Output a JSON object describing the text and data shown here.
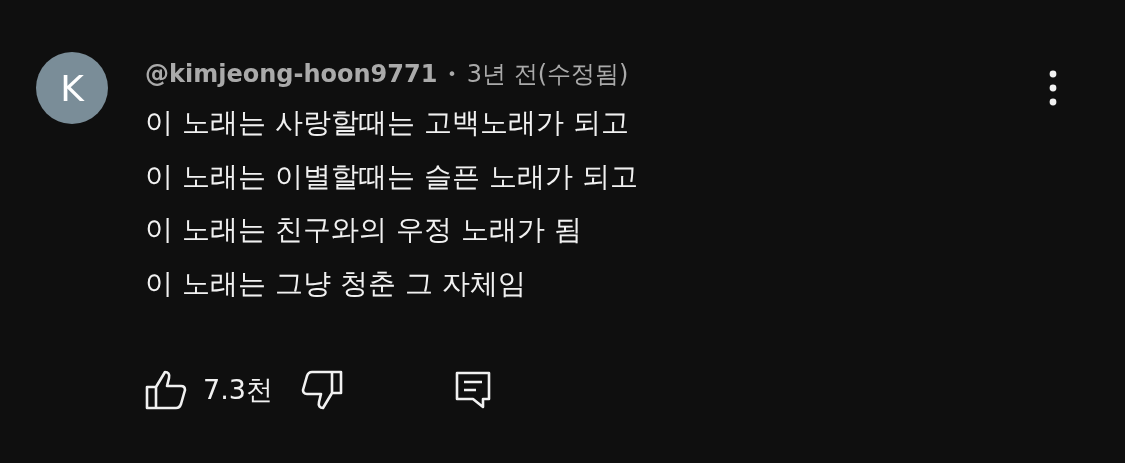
{
  "comment": {
    "avatar_letter": "K",
    "author": "@kimjeong-hoon9771",
    "separator": "•",
    "time": "3년 전(수정됨)",
    "lines": [
      "이 노래는 사랑할때는 고백노래가 되고",
      "이 노래는 이별할때는 슬픈 노래가 되고",
      "이 노래는 친구와의 우정 노래가 됨",
      "이 노래는 그냥 청춘 그 자체임"
    ],
    "like_count": "7.3천"
  }
}
